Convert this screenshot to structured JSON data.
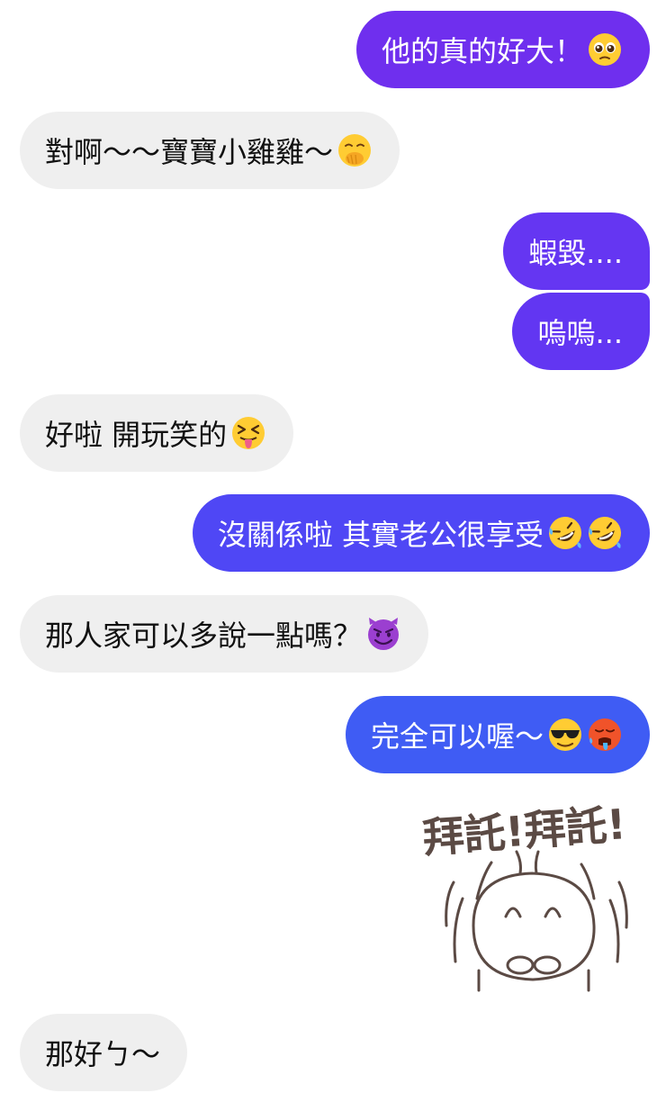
{
  "messages": [
    {
      "id": "m1",
      "side": "outgoing",
      "text": "他的真的好大！",
      "emoji": [
        "pleading-face"
      ]
    },
    {
      "id": "m2",
      "side": "incoming",
      "text": "對啊～～寶寶小雞雞～",
      "emoji": [
        "face-with-hand-over-mouth"
      ]
    },
    {
      "id": "m3",
      "side": "outgoing",
      "text": "蝦毀....",
      "emoji": []
    },
    {
      "id": "m4",
      "side": "outgoing",
      "text": "嗚嗚...",
      "emoji": []
    },
    {
      "id": "m5",
      "side": "incoming",
      "text": "好啦 開玩笑的",
      "emoji": [
        "squinting-face-with-tongue"
      ]
    },
    {
      "id": "m6",
      "side": "outgoing",
      "text": "沒關係啦 其實老公很享受",
      "emoji": [
        "rolling-on-floor-laughing",
        "rolling-on-floor-laughing"
      ]
    },
    {
      "id": "m7",
      "side": "incoming",
      "text": "那人家可以多說一點嗎？",
      "emoji": [
        "smiling-face-with-horns"
      ]
    },
    {
      "id": "m8",
      "side": "outgoing",
      "text": "完全可以喔～",
      "emoji": [
        "smiling-face-with-sunglasses",
        "hot-face"
      ]
    },
    {
      "id": "m9",
      "side": "incoming",
      "text": "那好ㄅ～",
      "emoji": []
    }
  ],
  "sticker": {
    "side": "outgoing",
    "text": "拜託!拜託!"
  },
  "colors": {
    "incoming_bubble": "#efefef",
    "outgoing_bubble_top": "#6f2fee",
    "outgoing_bubble_bottom": "#3f5cf4",
    "sticker_ink": "#5b4a44"
  }
}
